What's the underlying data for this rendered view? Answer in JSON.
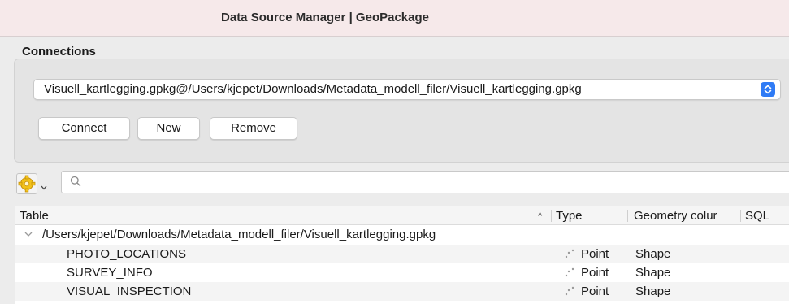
{
  "window": {
    "title": "Data Source Manager | GeoPackage"
  },
  "connections": {
    "label": "Connections",
    "selected": "Visuell_kartlegging.gpkg@/Users/kjepet/Downloads/Metadata_modell_filer/Visuell_kartlegging.gpkg",
    "buttons": {
      "connect": "Connect",
      "new": "New",
      "remove": "Remove"
    }
  },
  "toolbar": {
    "search_placeholder": ""
  },
  "table": {
    "headers": {
      "table": "Table",
      "sort": "^",
      "type": "Type",
      "geometry": "Geometry colur",
      "sql": "SQL"
    },
    "group": "/Users/kjepet/Downloads/Metadata_modell_filer/Visuell_kartlegging.gpkg",
    "rows": [
      {
        "name": "PHOTO_LOCATIONS",
        "type": "Point",
        "geometry": "Shape"
      },
      {
        "name": "SURVEY_INFO",
        "type": "Point",
        "geometry": "Shape"
      },
      {
        "name": "VISUAL_INSPECTION",
        "type": "Point",
        "geometry": "Shape"
      }
    ]
  },
  "colors": {
    "accent": "#2f7bf5",
    "titlebar": "#f6e9ea"
  }
}
